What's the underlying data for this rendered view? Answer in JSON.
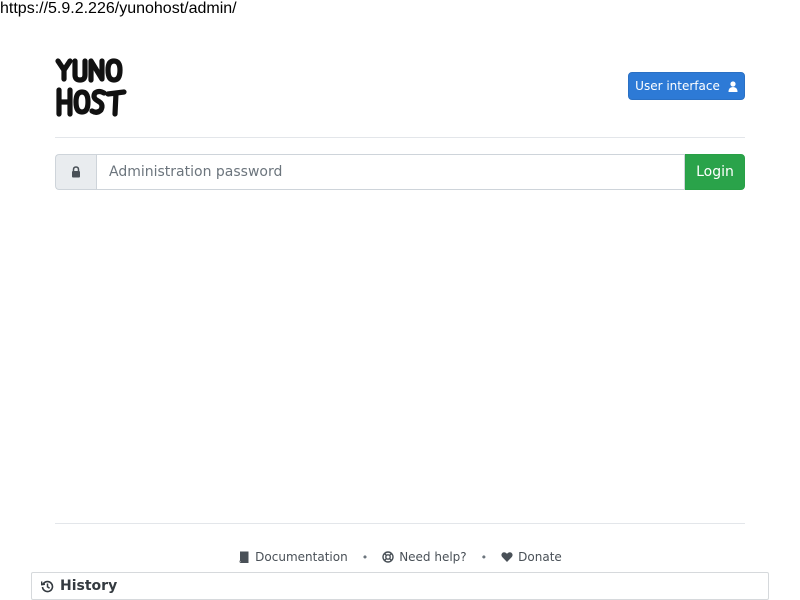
{
  "browser": {
    "url": "https://5.9.2.226/yunohost/admin/"
  },
  "header": {
    "logo_text": "YUNO HOST",
    "user_interface_label": "User interface"
  },
  "login": {
    "password_placeholder": "Administration password",
    "login_label": "Login"
  },
  "footer": {
    "links": [
      {
        "label": "Documentation",
        "icon": "book-icon"
      },
      {
        "label": "Need help?",
        "icon": "life-ring-icon"
      },
      {
        "label": "Donate",
        "icon": "heart-icon"
      }
    ],
    "separator": "•"
  },
  "history": {
    "label": "History",
    "icon": "history-icon"
  },
  "colors": {
    "primary": "#2d7ad6",
    "success": "#2aa34a"
  }
}
